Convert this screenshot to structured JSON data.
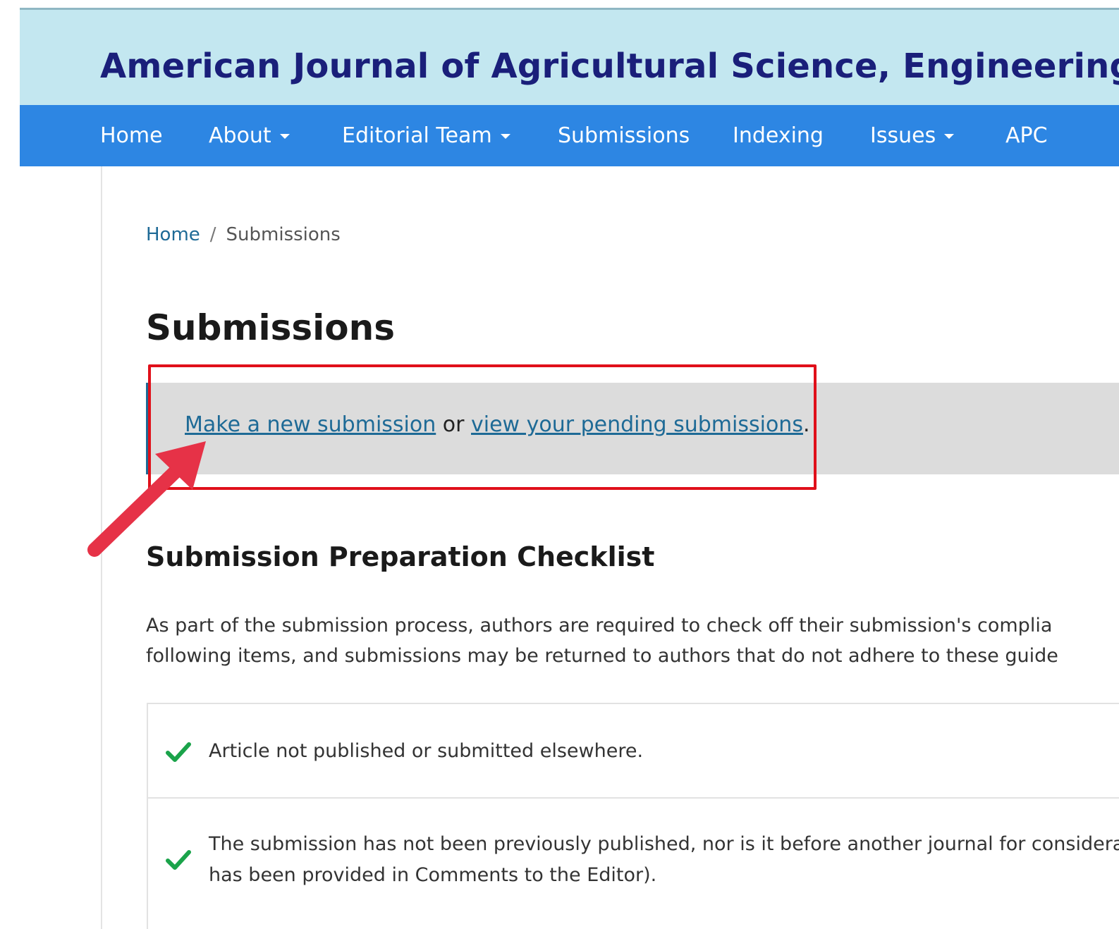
{
  "header": {
    "journal_title": "American Journal of Agricultural Science, Engineering,"
  },
  "nav": {
    "items": [
      {
        "label": "Home",
        "dropdown": false
      },
      {
        "label": "About",
        "dropdown": true
      },
      {
        "label": "Editorial Team",
        "dropdown": true
      },
      {
        "label": "Submissions",
        "dropdown": false
      },
      {
        "label": "Indexing",
        "dropdown": false
      },
      {
        "label": "Issues",
        "dropdown": true
      },
      {
        "label": "APC",
        "dropdown": false
      }
    ]
  },
  "breadcrumb": {
    "home": "Home",
    "separator": "/",
    "current": "Submissions"
  },
  "page": {
    "title": "Submissions"
  },
  "notice": {
    "new_submission_link": "Make a new submission",
    "or_text": " or ",
    "pending_link": "view your pending submissions",
    "period": "."
  },
  "checklist_section": {
    "title": "Submission Preparation Checklist",
    "intro_line1": "As part of the submission process, authors are required to check off their submission's complia",
    "intro_line2": "following items, and submissions may be returned to authors that do not adhere to these guide",
    "items": [
      {
        "line1": "Article not published or submitted elsewhere."
      },
      {
        "line1": "The submission has not been previously published, nor is it before another journal for considera",
        "line2": "has been provided in Comments to the Editor)."
      }
    ]
  },
  "colors": {
    "header_bg": "#c3e7f0",
    "title_color": "#1a1f7a",
    "nav_bg": "#2d86e3",
    "link_color": "#1e6a96",
    "highlight_red": "#e0101a",
    "arrow_color": "#e63247",
    "check_green": "#1aa34a"
  }
}
